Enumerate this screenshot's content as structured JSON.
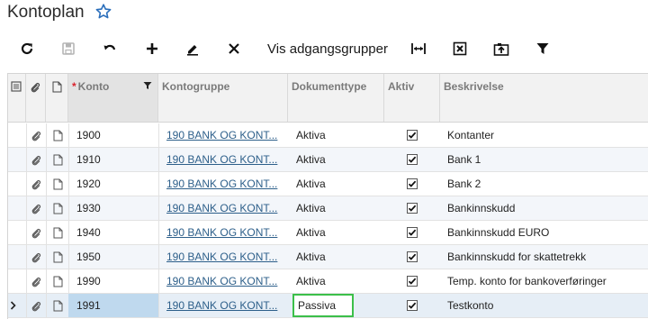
{
  "page": {
    "title": "Kontoplan",
    "star_icon": "star-outline-icon",
    "accent_color": "#2a6ebb"
  },
  "toolbar": {
    "icons": [
      "refresh-icon",
      "save-icon",
      "undo-icon",
      "add-icon",
      "edit-icon",
      "delete-icon",
      "fit-column-icon",
      "export-excel-icon",
      "upload-icon",
      "filter-icon"
    ],
    "vis_adgangsgrupper_label": "Vis adgangsgrupper"
  },
  "grid": {
    "columns": {
      "konto": "Konto",
      "kontogruppe": "Kontogruppe",
      "dokumenttype": "Dokumenttype",
      "aktiv": "Aktiv",
      "beskrivelse": "Beskrivelse"
    },
    "rows": [
      {
        "konto": "1900",
        "kontogruppe": "190 BANK OG KONT...",
        "dokumenttype": "Aktiva",
        "aktiv": true,
        "beskrivelse": "Kontanter"
      },
      {
        "konto": "1910",
        "kontogruppe": "190 BANK OG KONT...",
        "dokumenttype": "Aktiva",
        "aktiv": true,
        "beskrivelse": "Bank 1"
      },
      {
        "konto": "1920",
        "kontogruppe": "190 BANK OG KONT...",
        "dokumenttype": "Aktiva",
        "aktiv": true,
        "beskrivelse": "Bank 2"
      },
      {
        "konto": "1930",
        "kontogruppe": "190 BANK OG KONT...",
        "dokumenttype": "Aktiva",
        "aktiv": true,
        "beskrivelse": "Bankinnskudd"
      },
      {
        "konto": "1940",
        "kontogruppe": "190 BANK OG KONT...",
        "dokumenttype": "Aktiva",
        "aktiv": true,
        "beskrivelse": "Bankinnskudd EURO"
      },
      {
        "konto": "1950",
        "kontogruppe": "190 BANK OG KONT...",
        "dokumenttype": "Aktiva",
        "aktiv": true,
        "beskrivelse": "Bankinnskudd for skattetrekk"
      },
      {
        "konto": "1990",
        "kontogruppe": "190 BANK OG KONT...",
        "dokumenttype": "Aktiva",
        "aktiv": true,
        "beskrivelse": "Temp. konto for bankoverføringer"
      },
      {
        "konto": "1991",
        "kontogruppe": "190 BANK OG KONT...",
        "dokumenttype": "Passiva",
        "aktiv": true,
        "beskrivelse": "Testkonto"
      }
    ],
    "active_row": 7
  }
}
